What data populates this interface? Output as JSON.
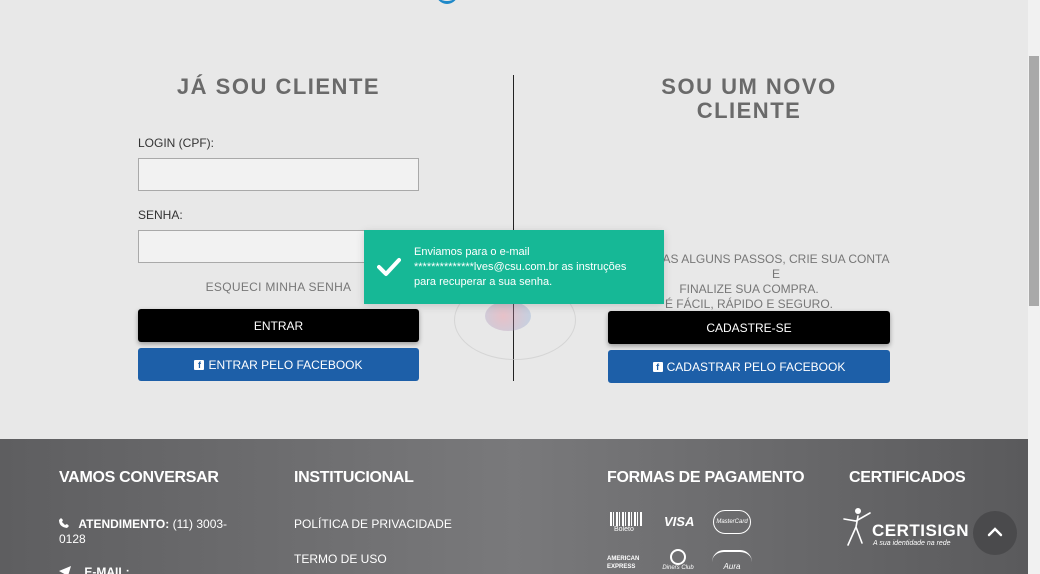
{
  "login": {
    "title": "JÁ SOU CLIENTE",
    "cpf_label": "LOGIN (CPF):",
    "cpf_value": "",
    "password_label": "SENHA:",
    "password_value": "",
    "forgot_label": "ESQUECI MINHA SENHA",
    "submit_label": "ENTRAR",
    "facebook_label": "ENTRAR PELO FACEBOOK"
  },
  "register": {
    "title": "SOU UM NOVO CLIENTE",
    "desc_line1": "AS ALGUNS PASSOS, CRIE SUA CONTA E",
    "desc_line2": "FINALIZE SUA COMPRA.",
    "desc_line3": "É FÁCIL, RÁPIDO E SEGURO.",
    "submit_label": "CADASTRE-SE",
    "facebook_label": "CADASTRAR PELO FACEBOOK"
  },
  "toast": {
    "message_line1": "Enviamos para o e-mail",
    "message_line2": "**************lves@csu.com.br as instruções",
    "message_line3": "para recuperar a sua senha."
  },
  "footer": {
    "contact": {
      "heading": "VAMOS CONVERSAR",
      "phone_label": "ATENDIMENTO:",
      "phone_value": "(11) 3003-",
      "phone_value2": "0128",
      "email_label": "E-MAIL:"
    },
    "institutional": {
      "heading": "INSTITUCIONAL",
      "links": [
        "POLÍTICA DE PRIVACIDADE",
        "TERMO DE USO"
      ]
    },
    "payment": {
      "heading": "FORMAS DE PAGAMENTO",
      "boleto": "Boleto",
      "visa": "VISA",
      "mastercard": "MasterCard",
      "amex": "AMERICAN EXPRESS",
      "diners": "Diners Club",
      "aura": "Aura"
    },
    "certificates": {
      "heading": "CERTIFICADOS",
      "brand": "CERTISIGN",
      "tagline": "A sua identidade na rede"
    }
  },
  "colors": {
    "toast": "#16b896",
    "facebook": "#1d5fa8",
    "footer": "#6b6b6d"
  }
}
